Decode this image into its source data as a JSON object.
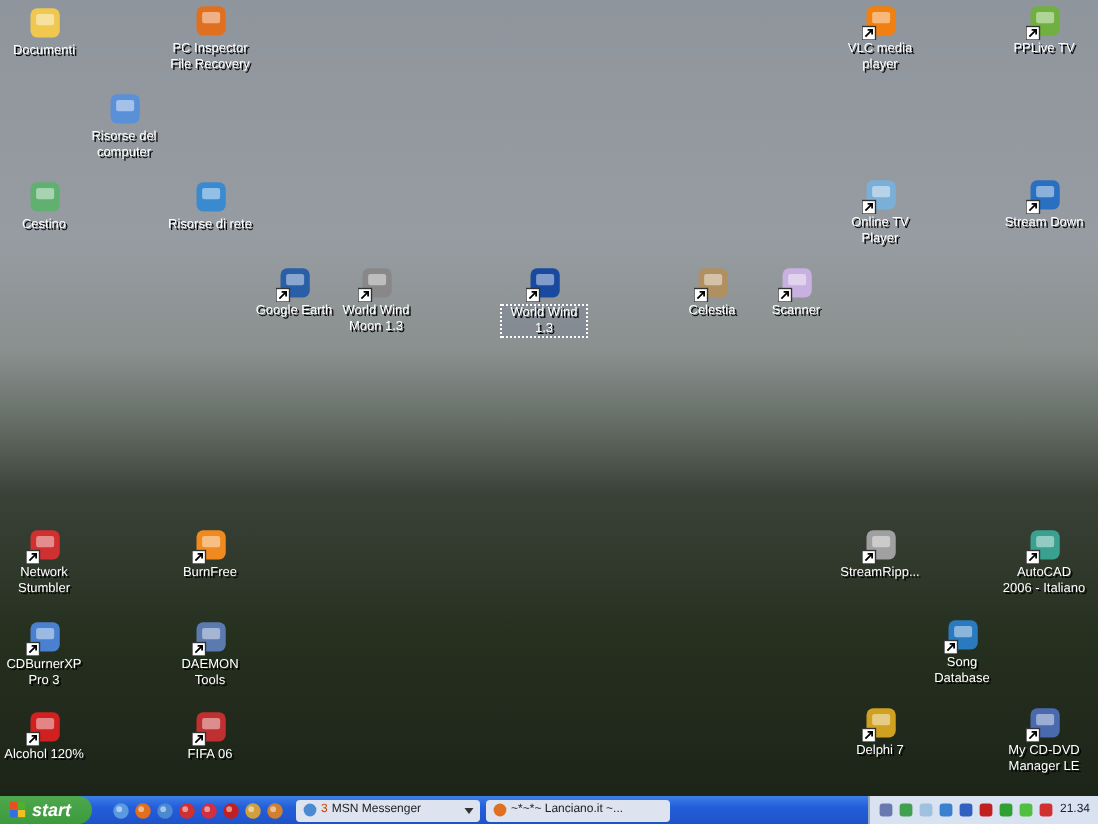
{
  "desktop": {
    "icons": [
      {
        "label": "Documenti",
        "selected": false
      },
      {
        "label": "PC Inspector File Recovery",
        "selected": false
      },
      {
        "label": "Risorse del computer",
        "selected": false
      },
      {
        "label": "Cestino",
        "selected": false
      },
      {
        "label": "Risorse di rete",
        "selected": false
      },
      {
        "label": "Google Earth",
        "selected": false
      },
      {
        "label": "World Wind Moon 1.3",
        "selected": false
      },
      {
        "label": "World Wind 1.3",
        "selected": true
      },
      {
        "label": "Celestia",
        "selected": false
      },
      {
        "label": "Scanner",
        "selected": false
      },
      {
        "label": "VLC media player",
        "selected": false
      },
      {
        "label": "PPLive TV",
        "selected": false
      },
      {
        "label": "Online TV Player",
        "selected": false
      },
      {
        "label": "Stream Down",
        "selected": false
      },
      {
        "label": "Network Stumbler",
        "selected": false
      },
      {
        "label": "BurnFree",
        "selected": false
      },
      {
        "label": "CDBurnerXP Pro 3",
        "selected": false
      },
      {
        "label": "DAEMON Tools",
        "selected": false
      },
      {
        "label": "Alcohol 120%",
        "selected": false
      },
      {
        "label": "FIFA 06",
        "selected": false
      },
      {
        "label": "StreamRipp...",
        "selected": false
      },
      {
        "label": "AutoCAD 2006 - Italiano",
        "selected": false
      },
      {
        "label": "Song Database",
        "selected": false
      },
      {
        "label": "Delphi 7",
        "selected": false
      },
      {
        "label": "My CD-DVD Manager LE",
        "selected": false
      }
    ]
  },
  "taskbar": {
    "start": "start",
    "buttons": [
      {
        "count": "3",
        "label": "MSN Messenger",
        "grouped": true
      },
      {
        "label": "~*~*~ Lanciano.it ~...",
        "grouped": false
      }
    ],
    "clock": "21.34"
  }
}
